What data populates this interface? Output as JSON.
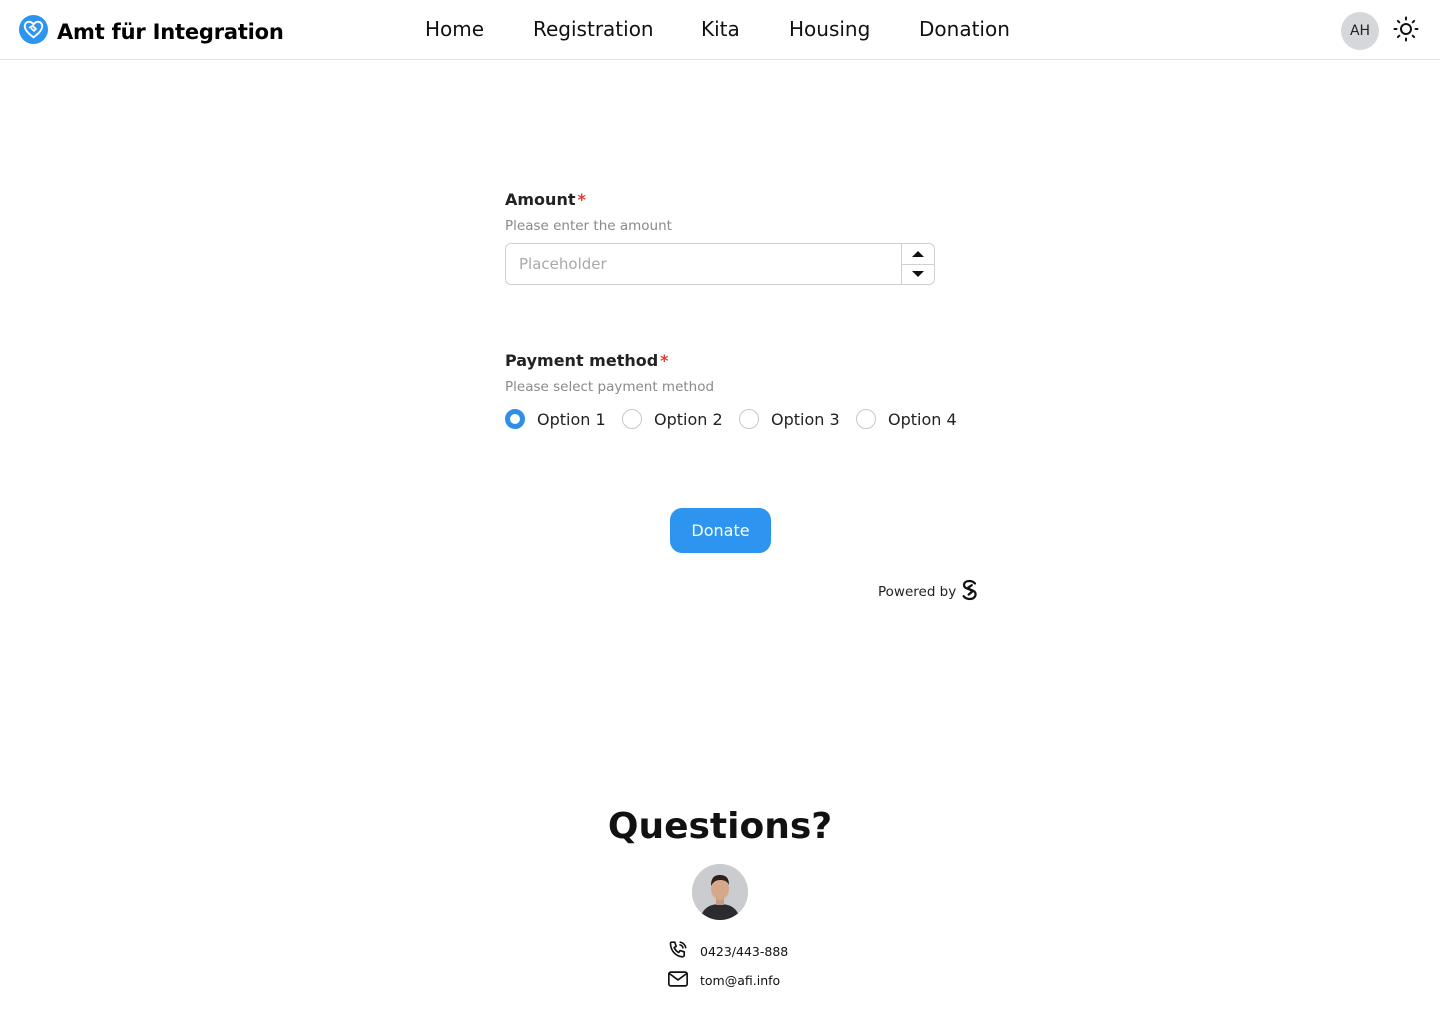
{
  "header": {
    "title": "Amt für Integration",
    "logo_icon": "heart-handshake-icon",
    "nav": {
      "home": "Home",
      "registration": "Registration",
      "kita": "Kita",
      "housing": "Housing",
      "donation": "Donation"
    },
    "avatar_initials": "AH",
    "theme_icon": "sun-icon"
  },
  "form": {
    "amount": {
      "label": "Amount",
      "required_mark": "*",
      "help": "Please enter the amount",
      "placeholder": "Placeholder",
      "value": ""
    },
    "payment": {
      "label": "Payment method",
      "required_mark": "*",
      "help": "Please select payment method",
      "options": [
        "Option 1",
        "Option 2",
        "Option 3",
        "Option 4"
      ],
      "selected": "Option 1"
    },
    "donate_label": "Donate",
    "powered_by": "Powered by"
  },
  "footer": {
    "heading": "Questions?",
    "phone": "0423/443-888",
    "email": "tom@afi.info"
  },
  "colors": {
    "accent": "#2d95ef",
    "required": "#e53935"
  }
}
